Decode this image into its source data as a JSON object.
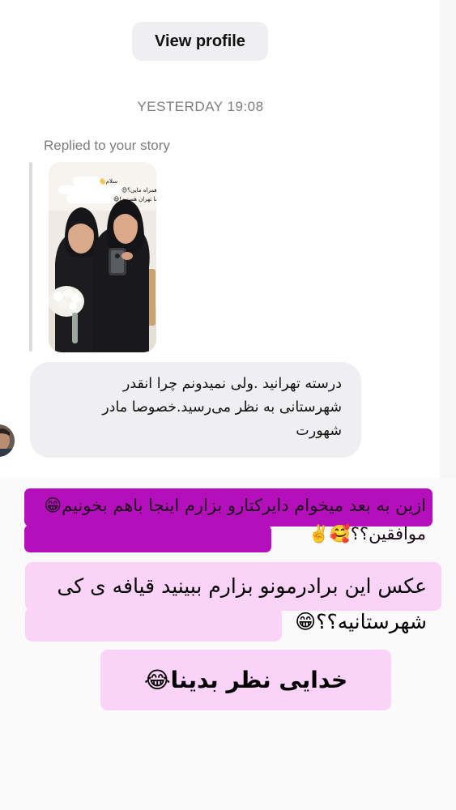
{
  "header": {
    "view_profile_label": "View profile"
  },
  "thread": {
    "timestamp": "YESTERDAY 19:08",
    "replied_label": "Replied to your story",
    "story_sticker": {
      "line1": "سلام👋",
      "line2": "از کدوم شهر همراه مایی؟😍",
      "line3": "ما تهران هستیم!😃"
    },
    "message_lines": [
      "درسته تهرانید .ولی نمیدونم چرا انقدر",
      "شهرستانی به نظر می‌رسید.خصوصا مادر",
      "شهورت"
    ]
  },
  "overlays": {
    "line1": "ازین به بعد میخوام دایرکتارو بزارم اینجا باهم بخونیم😁موافقین؟؟🥰✌️",
    "line2": "عکس این برادرمونو بزارم ببینید قیافه ی کی شهرستانیه؟؟😁",
    "line3": "خدایی نظر بدینا😂"
  },
  "colors": {
    "overlay_purple": "#b50fbc",
    "overlay_pink": "#fbd3f8",
    "bubble_gray": "#efeff2",
    "meta_gray": "#7d7d7d"
  }
}
